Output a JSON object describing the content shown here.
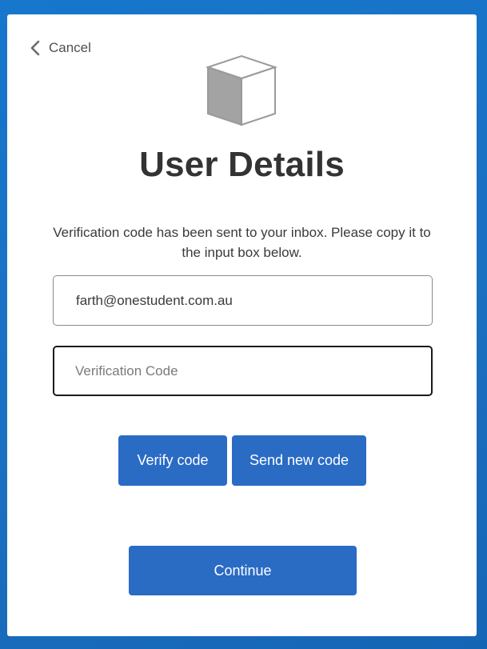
{
  "nav": {
    "cancel_label": "Cancel"
  },
  "logo": {
    "icon": "cube-icon"
  },
  "page": {
    "title": "User Details",
    "info_text": "Verification code has been sent to your inbox. Please copy it to the input box below."
  },
  "form": {
    "email_value": "farth@onestudent.com.au",
    "code_value": "",
    "code_placeholder": "Verification Code"
  },
  "buttons": {
    "verify_label": "Verify code",
    "send_new_label": "Send new code",
    "continue_label": "Continue"
  },
  "colors": {
    "background": "#1a73c4",
    "primary_button": "#2a6bc4"
  }
}
